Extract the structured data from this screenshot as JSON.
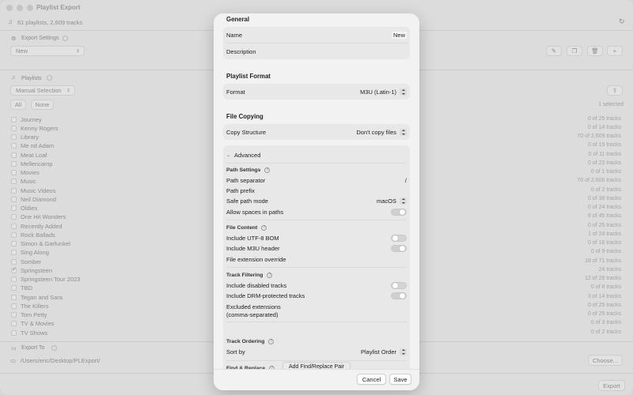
{
  "window": {
    "title": "Playlist Export",
    "summary": "61 playlists, 2,609 tracks"
  },
  "export_settings": {
    "heading": "Export Settings",
    "preset_value": "New"
  },
  "playlists": {
    "heading": "Playlists",
    "selection_mode": "Manual Selection",
    "all_label": "All",
    "none_label": "None",
    "selected_count": "1 selected",
    "items": [
      {
        "name": "Journey",
        "count": "0 of 25 tracks",
        "checked": false
      },
      {
        "name": "Kenny Rogers",
        "count": "0 of 14 tracks",
        "checked": false
      },
      {
        "name": "Library",
        "count": "70 of 2,609 tracks",
        "checked": false
      },
      {
        "name": "Me nd Adam",
        "count": "0 of 19 tracks",
        "checked": false
      },
      {
        "name": "Meat Loaf",
        "count": "0 of 11 tracks",
        "checked": false
      },
      {
        "name": "Mellencamp",
        "count": "0 of 23 tracks",
        "checked": false
      },
      {
        "name": "Movies",
        "count": "0 of 1 tracks",
        "checked": false
      },
      {
        "name": "Music",
        "count": "70 of 2,606 tracks",
        "checked": false
      },
      {
        "name": "Music Videos",
        "count": "0 of 2 tracks",
        "checked": false
      },
      {
        "name": "Neil Diamond",
        "count": "0 of 38 tracks",
        "checked": false
      },
      {
        "name": "Oldies",
        "count": "0 of 24 tracks",
        "checked": false
      },
      {
        "name": "One Hit Wonders",
        "count": "8 of 45 tracks",
        "checked": false
      },
      {
        "name": "Recently Added",
        "count": "0 of 25 tracks",
        "checked": false
      },
      {
        "name": "Rock Ballads",
        "count": "1 of 24 tracks",
        "checked": false
      },
      {
        "name": "Simon & Garfunkel",
        "count": "0 of 16 tracks",
        "checked": false
      },
      {
        "name": "Sing Along",
        "count": "0 of 9 tracks",
        "checked": false
      },
      {
        "name": "Somber",
        "count": "18 of 71 tracks",
        "checked": false
      },
      {
        "name": "Springsteen",
        "count": "24 tracks",
        "checked": true
      },
      {
        "name": "Springsteen Tour 2023",
        "count": "12 of 28 tracks",
        "checked": false
      },
      {
        "name": "TBD",
        "count": "0 of 8 tracks",
        "checked": false
      },
      {
        "name": "Tegan and Sara",
        "count": "3 of 14 tracks",
        "checked": false
      },
      {
        "name": "The Killers",
        "count": "0 of 25 tracks",
        "checked": false
      },
      {
        "name": "Tom Petty",
        "count": "0 of 25 tracks",
        "checked": false
      },
      {
        "name": "TV & Movies",
        "count": "0 of 3 tracks",
        "checked": false
      },
      {
        "name": "TV Shows",
        "count": "0 of 2 tracks",
        "checked": false
      }
    ]
  },
  "export_to": {
    "heading": "Export To",
    "path": "/Users/eric/Desktop/PLExport/",
    "choose_label": "Choose...",
    "export_label": "Export"
  },
  "sheet": {
    "general": {
      "title": "General",
      "name_label": "Name",
      "name_value": "New",
      "description_label": "Description"
    },
    "playlist_format": {
      "title": "Playlist Format",
      "format_label": "Format",
      "format_value": "M3U (Latin-1)"
    },
    "file_copying": {
      "title": "File Copying",
      "copy_label": "Copy Structure",
      "copy_value": "Don't copy files"
    },
    "advanced": {
      "title": "Advanced",
      "path_settings": {
        "heading": "Path Settings",
        "separator_label": "Path separator",
        "separator_value": "/",
        "prefix_label": "Path prefix",
        "safe_mode_label": "Safe path mode",
        "safe_mode_value": "macOS",
        "spaces_label": "Allow spaces in paths",
        "spaces_on": true
      },
      "file_content": {
        "heading": "File Content",
        "bom_label": "Include UTF-8 BOM",
        "bom_on": false,
        "header_label": "Include M3U header",
        "header_on": true,
        "ext_label": "File extension override"
      },
      "track_filtering": {
        "heading": "Track Filtering",
        "disabled_label": "Include disabled tracks",
        "disabled_on": false,
        "drm_label": "Include DRM-protected tracks",
        "drm_on": true,
        "excluded_label_1": "Excluded extensions",
        "excluded_label_2": "(comma-separated)"
      },
      "track_ordering": {
        "heading": "Track Ordering",
        "sort_label": "Sort by",
        "sort_value": "Playlist Order"
      },
      "find_replace": {
        "heading": "Find & Replace",
        "add_label": "Add Find/Replace Pair"
      }
    },
    "cancel_label": "Cancel",
    "save_label": "Save"
  }
}
